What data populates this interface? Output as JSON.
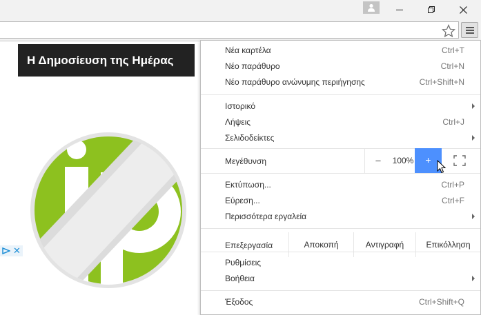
{
  "window": {
    "user_icon": "person-icon",
    "minimize_icon": "minimize-icon",
    "maximize_icon": "restore-icon",
    "close_icon": "close-icon"
  },
  "toolbar": {
    "bookmark_icon": "star-icon",
    "menu_icon": "hamburger-icon"
  },
  "page": {
    "post_title": "Η Δημοσίευση της Ημέρας",
    "logo_icon": "blocked-ip-logo",
    "logo_color": "#8dc11f",
    "ad_icons": [
      "adchoices-icon",
      "close-icon"
    ],
    "ad_close_glyph": "✕"
  },
  "menu": {
    "items_top": [
      {
        "label": "Νέα καρτέλα",
        "shortcut": "Ctrl+T"
      },
      {
        "label": "Νέο παράθυρο",
        "shortcut": "Ctrl+N"
      },
      {
        "label": "Νέο παράθυρο ανώνυμης περιήγησης",
        "shortcut": "Ctrl+Shift+N"
      }
    ],
    "items_history": [
      {
        "label": "Ιστορικό",
        "shortcut": ""
      },
      {
        "label": "Λήψεις",
        "shortcut": "Ctrl+J"
      },
      {
        "label": "Σελιδοδείκτες",
        "shortcut": ""
      }
    ],
    "zoom": {
      "label": "Μεγέθυνση",
      "minus": "–",
      "value": "100%",
      "plus": "+",
      "fullscreen_icon": "fullscreen-icon",
      "accent": "#4d90fe"
    },
    "items_tools": [
      {
        "label": "Εκτύπωση...",
        "shortcut": "Ctrl+P"
      },
      {
        "label": "Εύρεση...",
        "shortcut": "Ctrl+F"
      },
      {
        "label": "Περισσότερα εργαλεία",
        "shortcut": ""
      }
    ],
    "edit": {
      "label": "Επεξεργασία",
      "cut": "Αποκοπή",
      "copy": "Αντιγραφή",
      "paste": "Επικόλληση"
    },
    "items_settings": [
      {
        "label": "Ρυθμίσεις",
        "shortcut": ""
      },
      {
        "label": "Βοήθεια",
        "shortcut": ""
      }
    ],
    "exit": {
      "label": "Έξοδος",
      "shortcut": "Ctrl+Shift+Q"
    }
  }
}
